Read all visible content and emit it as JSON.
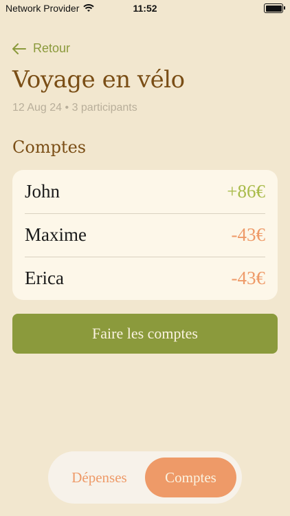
{
  "status_bar": {
    "carrier": "Network Provider",
    "time": "11:52"
  },
  "nav": {
    "back_label": "Retour"
  },
  "header": {
    "title": "Voyage en vélo",
    "subtitle": "12 Aug 24 • 3 participants"
  },
  "accounts": {
    "section_title": "Comptes",
    "rows": [
      {
        "name": "John",
        "amount": "+86€",
        "status": "positive"
      },
      {
        "name": "Maxime",
        "amount": "-43€",
        "status": "negative"
      },
      {
        "name": "Erica",
        "amount": "-43€",
        "status": "negative"
      }
    ]
  },
  "actions": {
    "settle_label": "Faire les comptes"
  },
  "tabs": [
    {
      "label": "Dépenses",
      "active": false
    },
    {
      "label": "Comptes",
      "active": true
    }
  ],
  "colors": {
    "background": "#f2e7cf",
    "accent_green": "#8b9a3c",
    "accent_orange": "#ee9a68",
    "title_brown": "#7a4e16"
  },
  "icons": {
    "back": "arrow-left-icon",
    "wifi": "wifi-icon",
    "battery": "battery-icon"
  }
}
